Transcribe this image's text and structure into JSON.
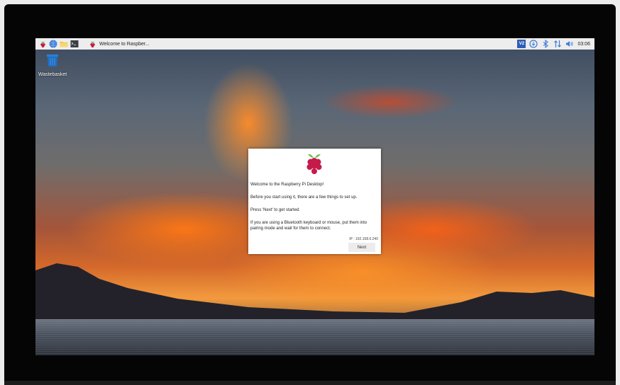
{
  "taskbar": {
    "launcher_icons": [
      "raspberry-menu-icon",
      "web-browser-icon",
      "file-manager-icon",
      "terminal-icon"
    ],
    "task_title": "Welcome to Raspber...",
    "tray": {
      "vnc_label": "V2",
      "clock": "03:06"
    }
  },
  "desktop": {
    "wastebasket_label": "Wastebasket"
  },
  "dialog": {
    "welcome": "Welcome to the Raspberry Pi Desktop!",
    "intro": "Before you start using it, there are a few things to set up.",
    "press_next": "Press 'Next' to get started.",
    "bluetooth": "If you are using a Bluetooth keyboard or mouse, put them into pairing mode and wait for them to connect.",
    "ip": "IP : 192.168.6.240",
    "next_label": "Next"
  },
  "colors": {
    "taskbar_bg": "#ededed",
    "vnc_accent": "#2e5cb8",
    "raspberry_red": "#c51a4a",
    "leaf_green": "#6cc04a",
    "tray_blue": "#3a7bd5"
  }
}
